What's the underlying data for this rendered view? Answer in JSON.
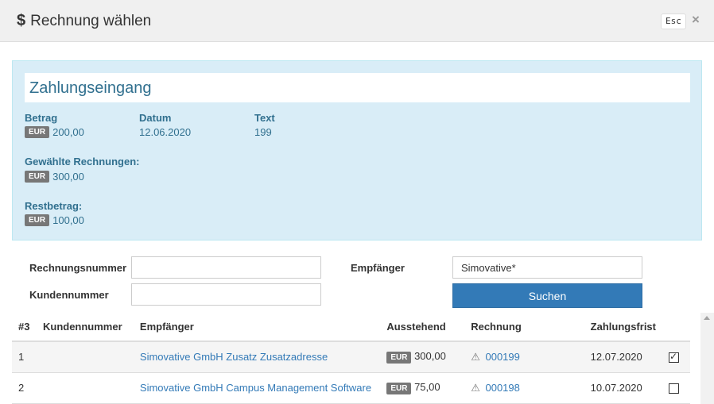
{
  "header": {
    "icon": "dollar-icon",
    "title": "Rechnung wählen",
    "esc_label": "Esc",
    "close_icon": "close-icon"
  },
  "payment": {
    "title": "Zahlungseingang",
    "amount_label": "Betrag",
    "amount_currency": "EUR",
    "amount_value": "200,00",
    "date_label": "Datum",
    "date_value": "12.06.2020",
    "text_label": "Text",
    "text_value": "199",
    "selected_label": "Gewählte Rechnungen:",
    "selected_currency": "EUR",
    "selected_value": "300,00",
    "rest_label": "Restbetrag:",
    "rest_currency": "EUR",
    "rest_value": "100,00"
  },
  "search": {
    "invoice_number_label": "Rechnungsnummer",
    "invoice_number_value": "",
    "customer_number_label": "Kundennummer",
    "customer_number_value": "",
    "recipient_label": "Empfänger",
    "recipient_value": "Simovative*",
    "search_button": "Suchen"
  },
  "table": {
    "headers": [
      "#3",
      "Kundennummer",
      "Empfänger",
      "Ausstehend",
      "Rechnung",
      "Zahlungsfrist"
    ],
    "rows": [
      {
        "index": "1",
        "customer_number": "",
        "recipient": "Simovative GmbH Zusatz Zusatzadresse",
        "currency": "EUR",
        "outstanding": "300,00",
        "invoice": "000199",
        "due_date": "12.07.2020",
        "selected": true
      },
      {
        "index": "2",
        "customer_number": "",
        "recipient": "Simovative GmbH Campus Management Software",
        "currency": "EUR",
        "outstanding": "75,00",
        "invoice": "000198",
        "due_date": "10.07.2020",
        "selected": false
      }
    ]
  },
  "colors": {
    "accent": "#337ab7",
    "panel_bg": "#d9edf7",
    "panel_text": "#31708f"
  }
}
